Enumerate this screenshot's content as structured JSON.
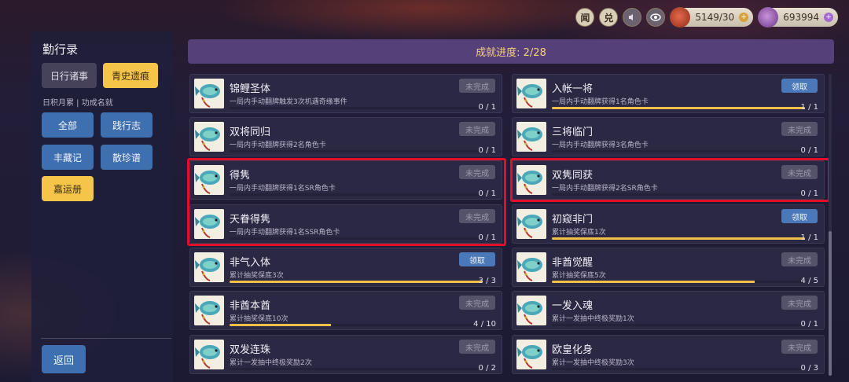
{
  "topbar": {
    "btn_news": "闻",
    "btn_exchange": "兑",
    "btn_sound_icon": "speaker-icon",
    "btn_view_icon": "eye-icon",
    "resource1": {
      "value": "5149/30",
      "icon": "red-bag-icon"
    },
    "resource2": {
      "value": "693994",
      "icon": "purple-purse-icon"
    }
  },
  "sidebar": {
    "title": "勤行录",
    "tabs": [
      {
        "label": "日行诸事",
        "active": false
      },
      {
        "label": "青史遗痕",
        "active": true
      }
    ],
    "subtitle": "日积月累 | 功成名就",
    "categories": [
      {
        "label": "全部",
        "active": false
      },
      {
        "label": "践行志",
        "active": false
      },
      {
        "label": "丰藏记",
        "active": false
      },
      {
        "label": "散珍谱",
        "active": false
      },
      {
        "label": "嘉运册",
        "active": true
      }
    ],
    "back_label": "返回"
  },
  "header": {
    "progress_text": "成就进度: 2/28"
  },
  "status_labels": {
    "pending": "未完成",
    "claim": "领取"
  },
  "colors": {
    "highlight": "#e0102a",
    "accent_gold": "#f4c548",
    "button_blue": "#3e6fae",
    "header_purple": "#55407a"
  },
  "achievements": [
    {
      "name": "锦鲤圣体",
      "desc": "一局内手动翻牌触发3次机遇奇缘事件",
      "status": "未完成",
      "progress": "0 / 1",
      "fill": 0
    },
    {
      "name": "入帐一将",
      "desc": "一局内手动翻牌获得1名角色卡",
      "status": "领取",
      "progress": "1 / 1",
      "fill": 1
    },
    {
      "name": "双将同归",
      "desc": "一局内手动翻牌获得2名角色卡",
      "status": "未完成",
      "progress": "0 / 1",
      "fill": 0
    },
    {
      "name": "三将临门",
      "desc": "一局内手动翻牌获得3名角色卡",
      "status": "未完成",
      "progress": "0 / 1",
      "fill": 0
    },
    {
      "name": "得隽",
      "desc": "一局内手动翻牌获得1名SR角色卡",
      "status": "未完成",
      "progress": "0 / 1",
      "fill": 0
    },
    {
      "name": "双隽同获",
      "desc": "一局内手动翻牌获得2名SR角色卡",
      "status": "未完成",
      "progress": "0 / 1",
      "fill": 0
    },
    {
      "name": "天眷得隽",
      "desc": "一局内手动翻牌获得1名SSR角色卡",
      "status": "未完成",
      "progress": "0 / 1",
      "fill": 0
    },
    {
      "name": "初窥非门",
      "desc": "累计抽奖保底1次",
      "status": "领取",
      "progress": "1 / 1",
      "fill": 1
    },
    {
      "name": "非气入体",
      "desc": "累计抽奖保底3次",
      "status": "领取",
      "progress": "3 / 3",
      "fill": 1
    },
    {
      "name": "非酋觉醒",
      "desc": "累计抽奖保底5次",
      "status": "未完成",
      "progress": "4 / 5",
      "fill": 0.8
    },
    {
      "name": "非酋本酋",
      "desc": "累计抽奖保底10次",
      "status": "未完成",
      "progress": "4 / 10",
      "fill": 0.4
    },
    {
      "name": "一发入魂",
      "desc": "累计一发抽中终极奖励1次",
      "status": "未完成",
      "progress": "0 / 1",
      "fill": 0
    },
    {
      "name": "双发连珠",
      "desc": "累计一发抽中终极奖励2次",
      "status": "未完成",
      "progress": "0 / 2",
      "fill": 0
    },
    {
      "name": "欧皇化身",
      "desc": "累计一发抽中终极奖励3次",
      "status": "未完成",
      "progress": "0 / 3",
      "fill": 0
    }
  ]
}
